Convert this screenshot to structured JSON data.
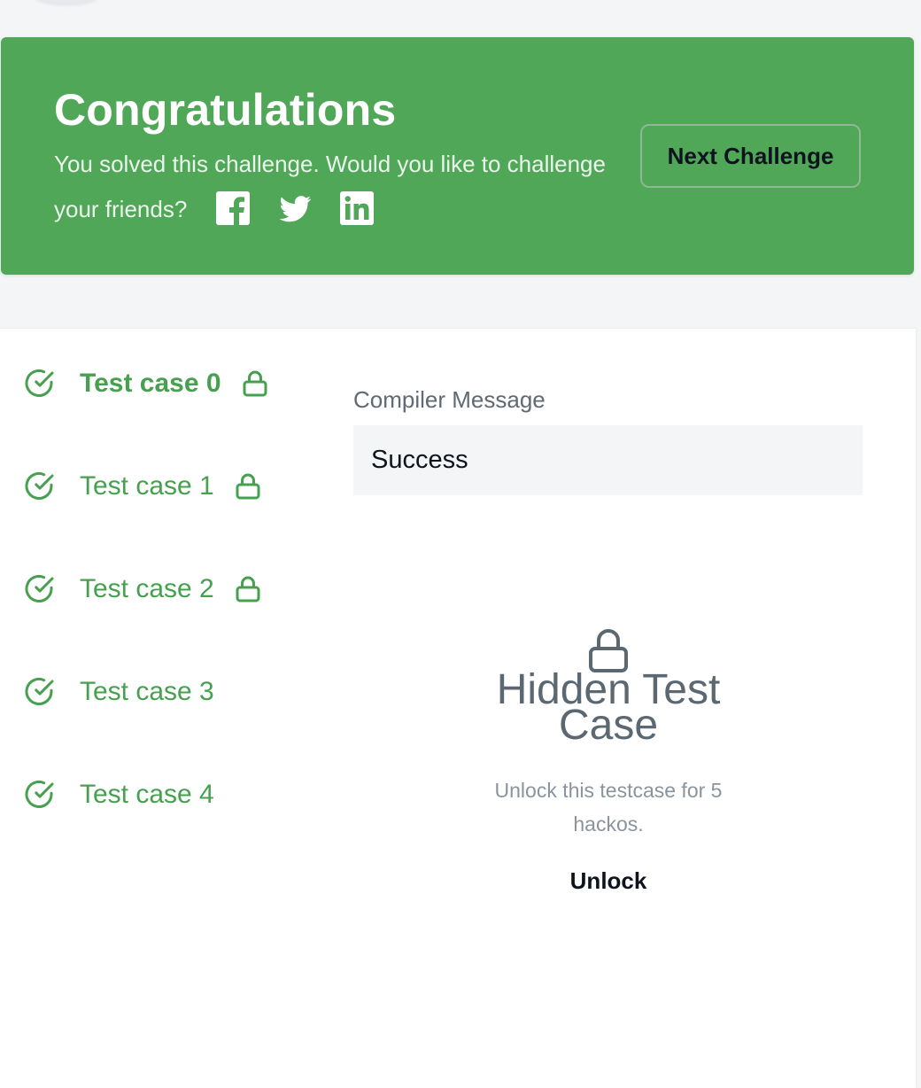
{
  "banner": {
    "title": "Congratulations",
    "message": "You solved this challenge. Would you like to challenge your friends?",
    "share_icons": [
      "facebook-icon",
      "twitter-icon",
      "linkedin-icon"
    ],
    "next_button": "Next Challenge",
    "background_color": "#51a758"
  },
  "test_cases": [
    {
      "label": "Test case 0",
      "active": true,
      "locked": true
    },
    {
      "label": "Test case 1",
      "active": false,
      "locked": true
    },
    {
      "label": "Test case 2",
      "active": false,
      "locked": true
    },
    {
      "label": "Test case 3",
      "active": false,
      "locked": false
    },
    {
      "label": "Test case 4",
      "active": false,
      "locked": false
    }
  ],
  "compiler": {
    "label": "Compiler Message",
    "value": "Success"
  },
  "hidden": {
    "title": "Hidden Test Case",
    "description": "Unlock this testcase for 5 hackos.",
    "unlock_button": "Unlock"
  },
  "colors": {
    "success_green": "#46a04f",
    "text_dark": "#0e141e",
    "text_muted": "#5b6872"
  }
}
